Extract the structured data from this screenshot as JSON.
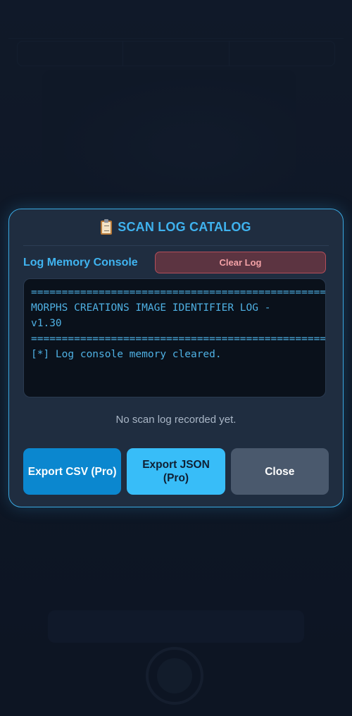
{
  "modal": {
    "icon": "clipboard-icon",
    "title": "SCAN LOG CATALOG",
    "console_label": "Log Memory Console",
    "clear_button": "Clear Log",
    "console_lines": [
      "================================================",
      "MORPHS CREATIONS IMAGE IDENTIFIER LOG - v1.30",
      "================================================",
      "[*] Log console memory cleared."
    ],
    "empty_note": "No scan log recorded yet.",
    "buttons": {
      "export_csv": "Export CSV (Pro)",
      "export_json": "Export JSON (Pro)",
      "close": "Close"
    }
  },
  "colors": {
    "accent": "#3fb2ee",
    "modal_border": "#3aa7e0",
    "clear_bg": "#5c3441",
    "clear_text": "#f3a1a6",
    "csv_button": "#0b87cf",
    "json_button": "#38bdf8",
    "close_button": "#4a596d"
  }
}
